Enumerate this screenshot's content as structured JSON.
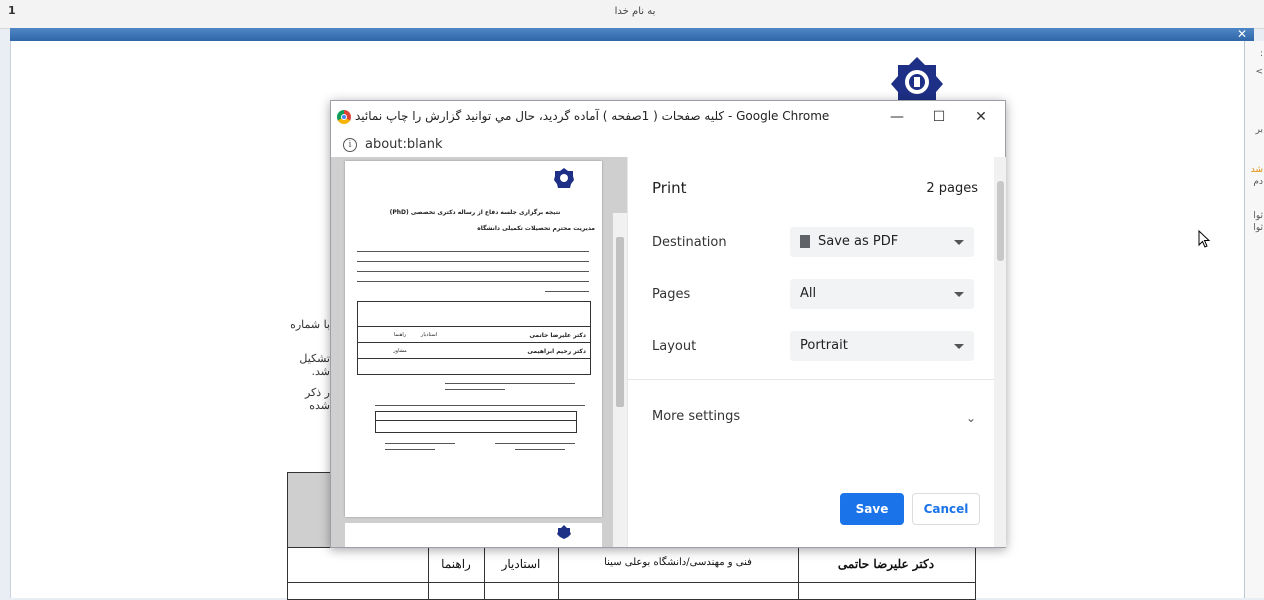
{
  "background": {
    "top_title": "به نام خدا",
    "side_texts": [
      "با شماره",
      "تشکیل شد.",
      "ر ذکر شده"
    ],
    "right_col_chars": [
      ":",
      "<",
      "بر",
      "شد",
      "دم",
      "ثوا",
      "ثوا"
    ],
    "table": {
      "row1": {
        "name": "دکتر علیرضا حاتمی",
        "affiliation": "فنی و مهندسی/دانشگاه بوعلی سینا",
        "rank": "استادیار",
        "role": "راهنما"
      }
    }
  },
  "dialog": {
    "title": "كليه صفحات ( 1صفحه ) آماده گرديد، حال مي توانيد گزارش را چاپ نمائيد - Google Chrome",
    "url": "about:blank",
    "window_buttons": {
      "minimize": "—",
      "maximize": "☐",
      "close": "✕"
    }
  },
  "print": {
    "heading": "Print",
    "page_count": "2 pages",
    "destination_label": "Destination",
    "destination_value": "Save as PDF",
    "pages_label": "Pages",
    "pages_value": "All",
    "layout_label": "Layout",
    "layout_value": "Portrait",
    "more_settings": "More settings",
    "save": "Save",
    "cancel": "Cancel"
  },
  "preview": {
    "doc_title": "نتیجه برگزاری جلسه دفاع از رساله دکتری تخصصی (PhD)",
    "doc_subtitle": "مدیریت محترم تحصیلات تکمیلی دانشگاه",
    "row1_name": "دکتر علیرضا حاتمی",
    "row2_name": "دکتر رحیم ابراهیمی",
    "col_rank": "استادیار",
    "col_role": "راهنما",
    "col_role2": "مشاور"
  },
  "colors": {
    "accent": "#1a73e8",
    "blue_bar": "#2f66a8"
  }
}
